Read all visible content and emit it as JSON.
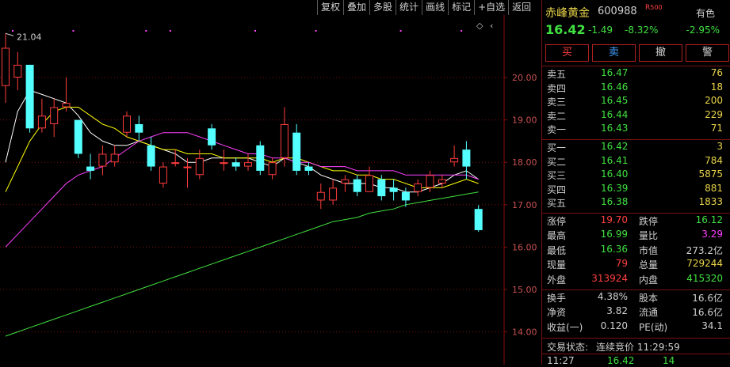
{
  "toolbar": [
    "复权",
    "叠加",
    "多股",
    "统计",
    "画线",
    "标记",
    "+自选",
    "返回"
  ],
  "colors": {
    "up": "#ff3c3c",
    "down": "#54ffff",
    "ma5": "#ffffff",
    "ma10": "#ffff00",
    "ma20": "#ff40ff",
    "ma60": "#40e040"
  },
  "chart_data": {
    "type": "candlestick",
    "ylim": [
      13.7,
      21.5
    ],
    "yticks": [
      "20.00",
      "19.00",
      "18.00",
      "17.00",
      "16.00",
      "15.00",
      "14.00"
    ],
    "max_label": "21.04",
    "candles": [
      {
        "o": 19.8,
        "c": 20.7,
        "h": 21.04,
        "l": 19.4
      },
      {
        "o": 20.0,
        "c": 20.3,
        "h": 20.6,
        "l": 19.7
      },
      {
        "o": 20.3,
        "c": 18.8,
        "h": 20.3,
        "l": 18.7
      },
      {
        "o": 18.8,
        "c": 19.1,
        "h": 19.5,
        "l": 18.7
      },
      {
        "o": 18.9,
        "c": 19.3,
        "h": 19.5,
        "l": 18.6
      },
      {
        "o": 19.3,
        "c": 19.4,
        "h": 20.0,
        "l": 19.2
      },
      {
        "o": 19.0,
        "c": 18.2,
        "h": 19.0,
        "l": 18.1
      },
      {
        "o": 17.9,
        "c": 17.8,
        "h": 18.2,
        "l": 17.6
      },
      {
        "o": 17.9,
        "c": 18.2,
        "h": 18.4,
        "l": 17.7
      },
      {
        "o": 18.0,
        "c": 18.2,
        "h": 18.4,
        "l": 17.9
      },
      {
        "o": 18.7,
        "c": 19.1,
        "h": 19.2,
        "l": 18.6
      },
      {
        "o": 18.9,
        "c": 18.7,
        "h": 19.1,
        "l": 18.5
      },
      {
        "o": 18.4,
        "c": 17.9,
        "h": 18.6,
        "l": 17.8
      },
      {
        "o": 17.5,
        "c": 17.9,
        "h": 18.0,
        "l": 17.4
      },
      {
        "o": 18.0,
        "c": 18.0,
        "h": 18.3,
        "l": 17.9
      },
      {
        "o": 17.9,
        "c": 17.9,
        "h": 18.1,
        "l": 17.4
      },
      {
        "o": 17.7,
        "c": 18.1,
        "h": 18.3,
        "l": 17.6
      },
      {
        "o": 18.8,
        "c": 18.4,
        "h": 18.9,
        "l": 18.3
      },
      {
        "o": 18.0,
        "c": 18.0,
        "h": 18.3,
        "l": 17.8
      },
      {
        "o": 18.0,
        "c": 17.9,
        "h": 18.1,
        "l": 17.8
      },
      {
        "o": 17.9,
        "c": 18.0,
        "h": 18.2,
        "l": 17.8
      },
      {
        "o": 18.4,
        "c": 17.8,
        "h": 18.5,
        "l": 17.7
      },
      {
        "o": 17.7,
        "c": 18.0,
        "h": 18.1,
        "l": 17.6
      },
      {
        "o": 18.1,
        "c": 18.9,
        "h": 19.3,
        "l": 17.9
      },
      {
        "o": 18.7,
        "c": 17.8,
        "h": 18.9,
        "l": 17.7
      },
      {
        "o": 17.9,
        "c": 17.8,
        "h": 18.0,
        "l": 17.7
      },
      {
        "o": 17.1,
        "c": 17.3,
        "h": 17.5,
        "l": 16.9
      },
      {
        "o": 17.1,
        "c": 17.4,
        "h": 17.6,
        "l": 17.0
      },
      {
        "o": 17.5,
        "c": 17.6,
        "h": 17.7,
        "l": 17.3
      },
      {
        "o": 17.6,
        "c": 17.3,
        "h": 17.7,
        "l": 17.2
      },
      {
        "o": 17.3,
        "c": 17.7,
        "h": 17.9,
        "l": 17.3
      },
      {
        "o": 17.6,
        "c": 17.2,
        "h": 17.7,
        "l": 17.1
      },
      {
        "o": 17.4,
        "c": 17.3,
        "h": 17.6,
        "l": 17.1
      },
      {
        "o": 17.3,
        "c": 17.1,
        "h": 17.4,
        "l": 16.95
      },
      {
        "o": 17.3,
        "c": 17.5,
        "h": 17.6,
        "l": 17.2
      },
      {
        "o": 17.4,
        "c": 17.7,
        "h": 17.8,
        "l": 17.3
      },
      {
        "o": 17.5,
        "c": 17.6,
        "h": 17.7,
        "l": 17.4
      },
      {
        "o": 18.0,
        "c": 18.1,
        "h": 18.4,
        "l": 17.9
      },
      {
        "o": 18.3,
        "c": 17.9,
        "h": 18.5,
        "l": 17.6
      },
      {
        "o": 16.9,
        "c": 16.4,
        "h": 16.99,
        "l": 16.36
      }
    ],
    "ma": [
      {
        "name": "ma5",
        "values": [
          18.0,
          19.2,
          19.7,
          19.6,
          19.5,
          19.4,
          19.1,
          18.7,
          18.5,
          18.4,
          18.4,
          18.5,
          18.4,
          18.3,
          18.2,
          18.0,
          18.0,
          18.1,
          18.1,
          18.1,
          18.1,
          18.0,
          17.9,
          18.1,
          18.0,
          17.9,
          17.7,
          17.6,
          17.5,
          17.5,
          17.5,
          17.4,
          17.4,
          17.3,
          17.3,
          17.4,
          17.5,
          17.7,
          17.8,
          17.6
        ]
      },
      {
        "name": "ma10",
        "values": [
          17.3,
          17.9,
          18.5,
          18.9,
          19.2,
          19.3,
          19.3,
          19.1,
          18.9,
          18.8,
          18.6,
          18.5,
          18.4,
          18.3,
          18.3,
          18.2,
          18.2,
          18.2,
          18.1,
          18.1,
          18.1,
          18.1,
          18.0,
          18.1,
          18.1,
          18.0,
          17.9,
          17.8,
          17.8,
          17.7,
          17.7,
          17.6,
          17.6,
          17.5,
          17.4,
          17.4,
          17.4,
          17.5,
          17.6,
          17.5
        ]
      },
      {
        "name": "ma20",
        "values": [
          16.0,
          16.3,
          16.6,
          16.9,
          17.2,
          17.5,
          17.7,
          17.8,
          17.9,
          18.1,
          18.3,
          18.5,
          18.6,
          18.7,
          18.7,
          18.7,
          18.6,
          18.5,
          18.4,
          18.3,
          18.2,
          18.2,
          18.1,
          18.1,
          18.0,
          18.0,
          17.9,
          17.9,
          17.9,
          17.8,
          17.8,
          17.8,
          17.8,
          17.7,
          17.7,
          17.7,
          17.7,
          17.7,
          17.7,
          17.6
        ]
      },
      {
        "name": "ma60",
        "values": [
          13.9,
          14.0,
          14.1,
          14.2,
          14.3,
          14.4,
          14.5,
          14.6,
          14.7,
          14.8,
          14.9,
          15.0,
          15.1,
          15.2,
          15.3,
          15.4,
          15.5,
          15.6,
          15.7,
          15.8,
          15.9,
          16.0,
          16.1,
          16.2,
          16.3,
          16.4,
          16.5,
          16.6,
          16.65,
          16.7,
          16.8,
          16.85,
          16.9,
          17.0,
          17.05,
          17.1,
          17.15,
          17.2,
          17.25,
          17.3
        ]
      }
    ]
  },
  "stock": {
    "name": "赤峰黄金",
    "code": "600988",
    "flag": "R",
    "flag_num": "500",
    "sector": "有色",
    "price": "16.42",
    "change": "-1.49",
    "pct": "-8.32%",
    "sector_pct": "-2.95%"
  },
  "tabs": [
    "买",
    "卖",
    "撤",
    "警"
  ],
  "asks": [
    {
      "label": "卖五",
      "price": "16.47",
      "vol": "76"
    },
    {
      "label": "卖四",
      "price": "16.46",
      "vol": "18"
    },
    {
      "label": "卖三",
      "price": "16.45",
      "vol": "200"
    },
    {
      "label": "卖二",
      "price": "16.44",
      "vol": "229"
    },
    {
      "label": "卖一",
      "price": "16.43",
      "vol": "71"
    }
  ],
  "bids": [
    {
      "label": "买一",
      "price": "16.42",
      "vol": "3"
    },
    {
      "label": "买二",
      "price": "16.41",
      "vol": "784"
    },
    {
      "label": "买三",
      "price": "16.40",
      "vol": "5875"
    },
    {
      "label": "买四",
      "price": "16.39",
      "vol": "881"
    },
    {
      "label": "买五",
      "price": "16.38",
      "vol": "1833"
    }
  ],
  "stats": {
    "zt_l": "涨停",
    "zt_v": "19.70",
    "dt_l": "跌停",
    "dt_v": "16.12",
    "hi_l": "最高",
    "hi_v": "16.99",
    "lb_l": "量比",
    "lb_v": "3.29",
    "lo_l": "最低",
    "lo_v": "16.36",
    "sz_l": "市值",
    "sz_v": "273.2亿",
    "xl_l": "现量",
    "xl_v": "79",
    "zl_l": "总量",
    "zl_v": "729244",
    "wp_l": "外盘",
    "wp_v": "313924",
    "np_l": "内盘",
    "np_v": "415320"
  },
  "stats2": {
    "hs_l": "换手",
    "hs_v": "4.38%",
    "gb_l": "股本",
    "gb_v": "16.6亿",
    "jz_l": "净资",
    "jz_v": "3.82",
    "lt_l": "流通",
    "lt_v": "16.6亿",
    "sy_l": "收益(一)",
    "sy_v": "0.120",
    "pe_l": "PE(动)",
    "pe_v": "34.1"
  },
  "status": {
    "label": "交易状态:",
    "value": "连续竞价 11:29:59"
  },
  "tick": {
    "time": "11:27",
    "price": "16.42",
    "vol": "14"
  }
}
